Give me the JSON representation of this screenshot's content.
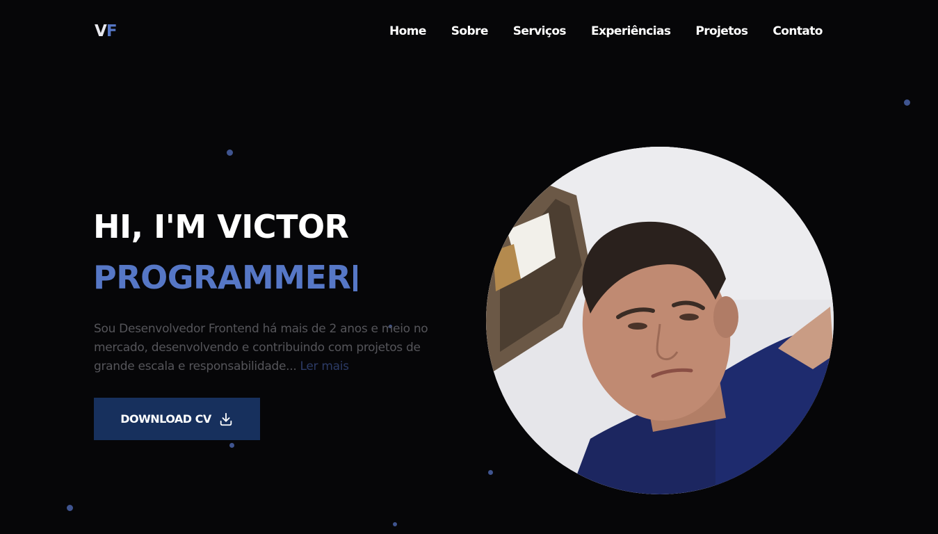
{
  "header": {
    "logo_first": "V",
    "logo_second": "F",
    "nav": [
      "Home",
      "Sobre",
      "Serviços",
      "Experiências",
      "Projetos",
      "Contato"
    ]
  },
  "hero": {
    "title": "HI, I'M VICTOR",
    "role": "PROGRAMMER",
    "description": "Sou Desenvolvedor Frontend há mais de 2 anos e meio no mercado, desenvolvendo e contribuindo com projetos de grande escala e responsabilidade...",
    "read_more": " Ler mais",
    "button_label": "DOWNLOAD CV",
    "button_icon": "download-icon",
    "photo": "profile-photo"
  },
  "colors": {
    "background": "#060608",
    "accent": "#5677c6",
    "button": "#17305d",
    "text_muted": "#55555a"
  }
}
